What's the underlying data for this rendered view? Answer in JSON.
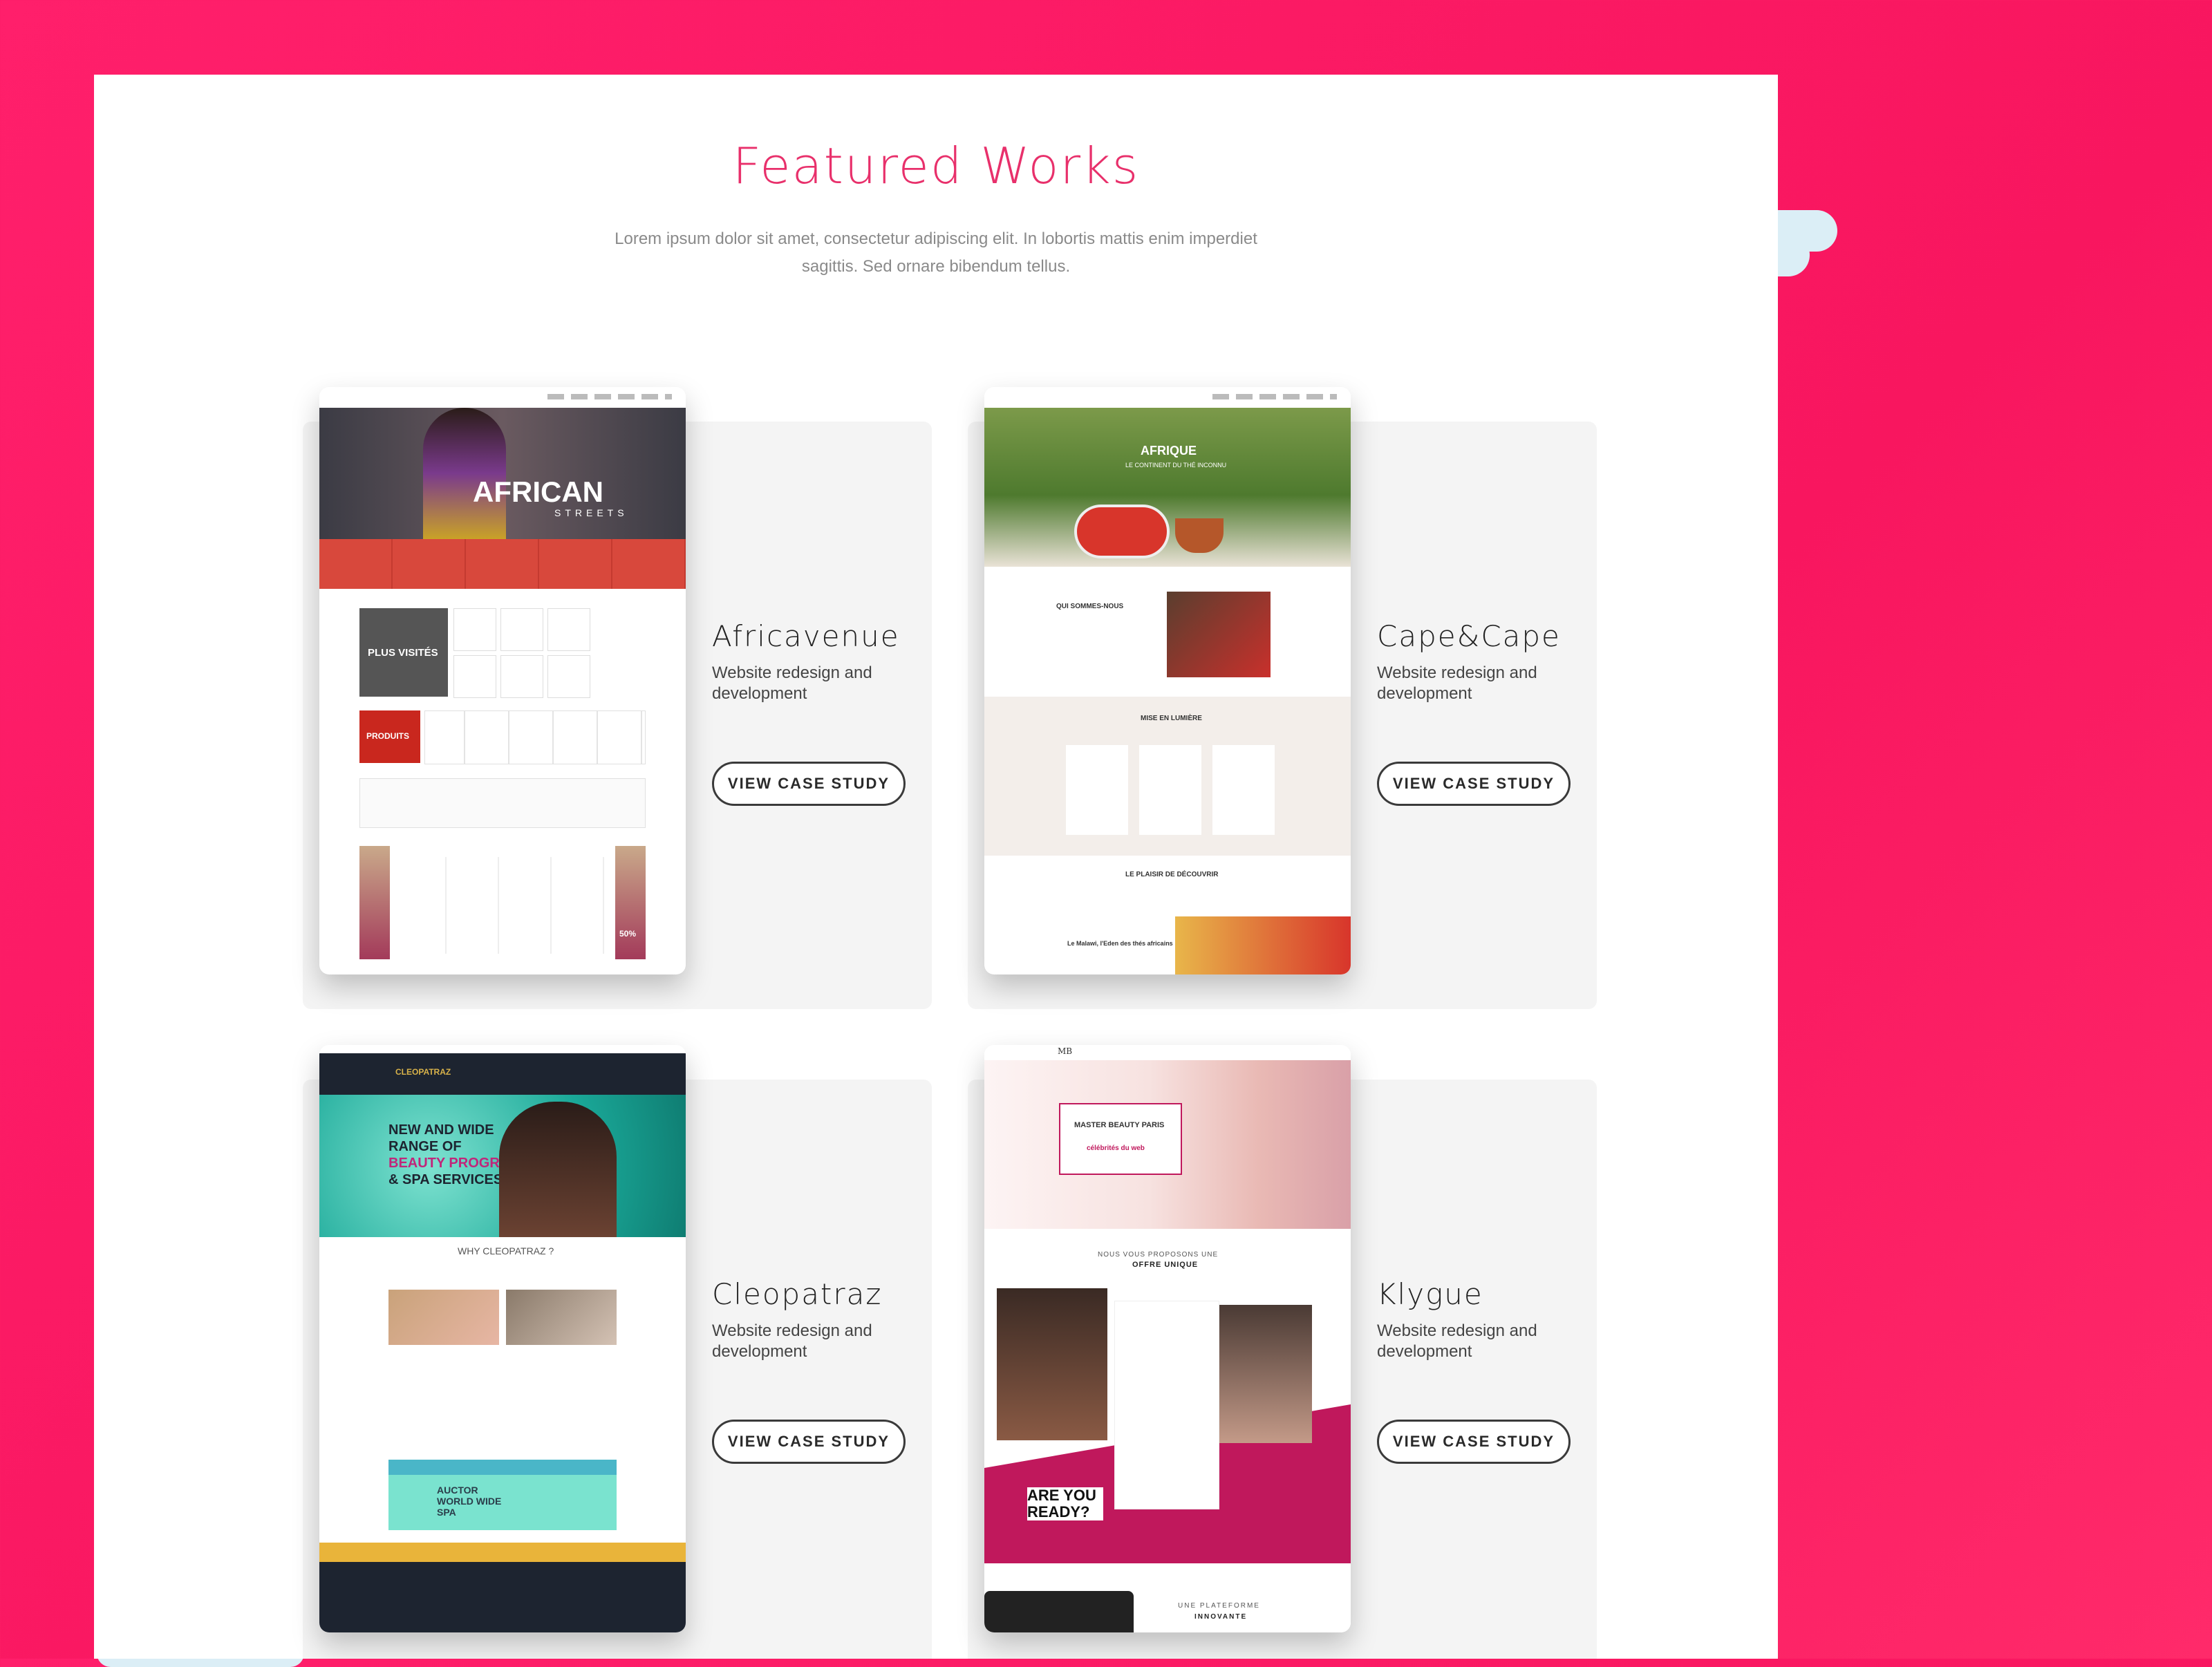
{
  "section": {
    "title": "Featured Works",
    "subtitle": "Lorem ipsum dolor sit amet, consectetur adipiscing elit. In lobortis mattis enim imperdiet sagittis. Sed ornare bibendum tellus."
  },
  "colors": {
    "accent": "#e8306b",
    "background": "#ff1f6b",
    "card": "#f4f4f4"
  },
  "works": [
    {
      "name": "Africavenue",
      "desc": "Website redesign and development",
      "button": "VIEW CASE STUDY",
      "shot": {
        "hero": "AFRICAN",
        "hero_sub": "STREETS",
        "promo": "PLUS VISITÉS",
        "products": "PRODUITS",
        "sale": "50%"
      }
    },
    {
      "name": "Cape&Cape",
      "desc": "Website redesign and development",
      "button": "VIEW CASE STUDY",
      "shot": {
        "hero": "AFRIQUE",
        "hero_sub": "LE CONTINENT DU THÉ INCONNU",
        "about": "QUI SOMMES-NOUS",
        "spotlight": "MISE EN LUMIÈRE",
        "discover": "LE PLAISIR DE DÉCOUVRIR",
        "feature": "Le Malawi, l'Eden des thés africains"
      }
    },
    {
      "name": "Cleopatraz",
      "desc": "Website redesign and development",
      "button": "VIEW CASE STUDY",
      "shot": {
        "brand": "CLEOPATRAZ",
        "hero_l1": "NEW AND WIDE",
        "hero_l2": "RANGE OF",
        "hero_l3": "BEAUTY PROGRAMS",
        "hero_l4": "& SPA SERVICES",
        "why": "WHY CLEOPATRAZ ?",
        "banner": "AUCTOR WORLD WIDE SPA"
      }
    },
    {
      "name": "Klygue",
      "desc": "Website redesign and development",
      "button": "VIEW CASE STUDY",
      "shot": {
        "brand": "MB",
        "box_title": "MASTER BEAUTY PARIS",
        "box_pink": "célébrités du web",
        "offer_l1": "NOUS VOUS PROPOSONS UNE",
        "offer_l2": "OFFRE UNIQUE",
        "ready": "ARE YOU READY?",
        "platform_l1": "UNE PLATEFORME",
        "platform_l2": "INNOVANTE"
      }
    }
  ]
}
